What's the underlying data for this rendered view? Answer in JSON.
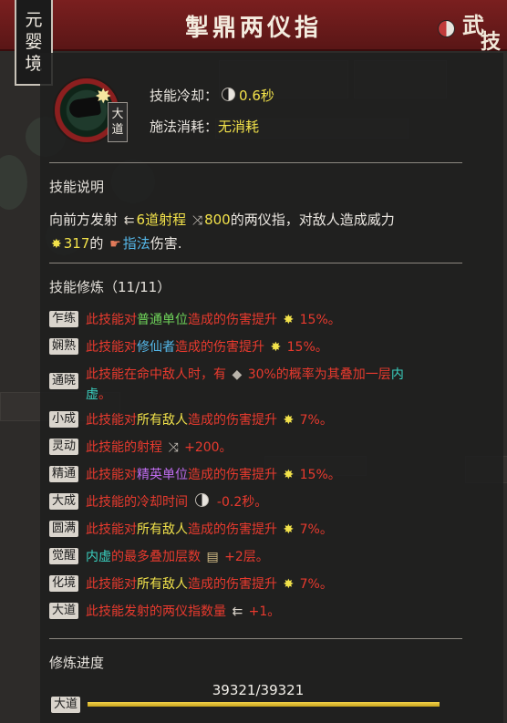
{
  "header": {
    "title": "掣鼎两仪指",
    "realm": [
      "元",
      "婴",
      "境"
    ],
    "logo": [
      "武",
      "技"
    ]
  },
  "skill": {
    "icon": "pointing-hand-burst-icon",
    "rank_badge": [
      "大",
      "道"
    ],
    "cooldown_label": "技能冷却：",
    "cooldown_value": "0.6秒",
    "cost_label": "施法消耗：",
    "cost_value": "无消耗"
  },
  "description": {
    "title": "技能说明",
    "line1_a": "向前方发射",
    "line1_b": "6道射程",
    "line1_c": "800",
    "line1_d": "的两仪指，对敌人造成威力",
    "line2_a": "317",
    "line2_b": "的",
    "line2_c": "指法",
    "line2_d": "伤害."
  },
  "cultivation": {
    "title": "技能修炼（11/11）",
    "rows": [
      {
        "tag": "乍练",
        "parts": [
          "此技能对",
          "普通单位",
          "造成的伤害提升",
          "15%。"
        ]
      },
      {
        "tag": "娴熟",
        "parts": [
          "此技能对",
          "修仙者",
          "造成的伤害提升",
          "15%。"
        ]
      },
      {
        "tag": "通晓",
        "parts": [
          "此技能在命中敌人时，有",
          "30%的概率为其叠加一层",
          "内",
          "虚",
          "。"
        ]
      },
      {
        "tag": "小成",
        "parts": [
          "此技能对",
          "所有敌人",
          "造成的伤害提升",
          "7%。"
        ]
      },
      {
        "tag": "灵动",
        "parts": [
          "此技能的射程",
          "+200。"
        ]
      },
      {
        "tag": "精通",
        "parts": [
          "此技能对",
          "精英单位",
          "造成的伤害提升",
          "15%。"
        ]
      },
      {
        "tag": "大成",
        "parts": [
          "此技能的冷却时间",
          "-0.2秒。"
        ]
      },
      {
        "tag": "圆满",
        "parts": [
          "此技能对",
          "所有敌人",
          "造成的伤害提升",
          "7%。"
        ]
      },
      {
        "tag": "觉醒",
        "parts": [
          "内虚",
          "的最多叠加层数",
          "+2层。"
        ]
      },
      {
        "tag": "化境",
        "parts": [
          "此技能对",
          "所有敌人",
          "造成的伤害提升",
          "7%。"
        ]
      },
      {
        "tag": "大道",
        "parts": [
          "此技能发射的两仪指数量",
          "+1。"
        ]
      }
    ]
  },
  "progress": {
    "title": "修炼进度",
    "value_text": "39321/39321",
    "fraction": 1.0,
    "tag": "大道"
  },
  "colors": {
    "yellow": "#f2e24a",
    "red": "#e93a2e",
    "blue": "#55b8ea",
    "green": "#6fd45a",
    "purple": "#c06cf0",
    "cyan": "#3ad0c0"
  }
}
